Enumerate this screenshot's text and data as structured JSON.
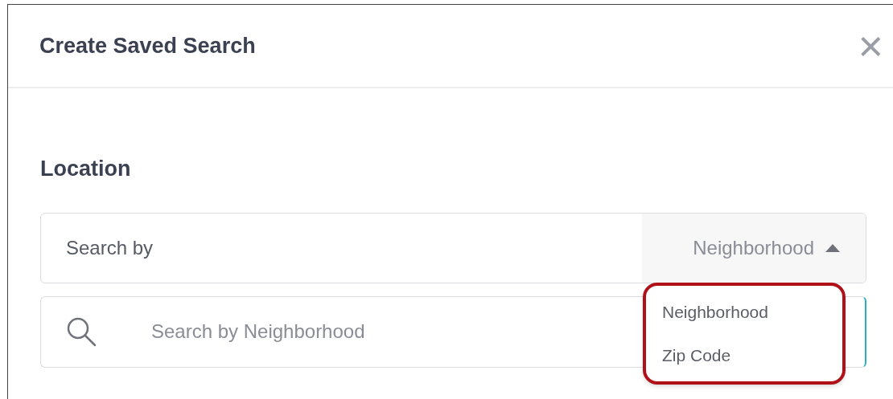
{
  "dialog": {
    "title": "Create Saved Search",
    "close": "×"
  },
  "location": {
    "label": "Location",
    "search_by": {
      "label": "Search by",
      "value": "Neighborhood",
      "expanded": true
    },
    "search_field": {
      "placeholder": "Search by Neighborhood"
    },
    "menu": {
      "highlighted": true,
      "options": [
        {
          "label": "Neighborhood"
        },
        {
          "label": "Zip Code"
        }
      ]
    }
  }
}
